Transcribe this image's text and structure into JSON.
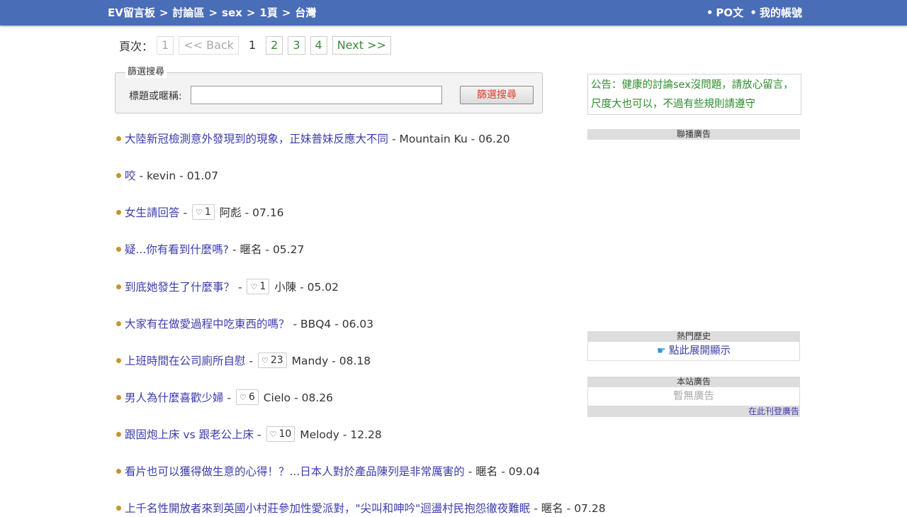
{
  "breadcrumb": {
    "items": [
      "EV留言板",
      "討論區",
      "sex",
      "1頁",
      "台灣"
    ],
    "separator": ">"
  },
  "top_nav": {
    "dot": "•",
    "post_label": "PO文",
    "account_label": "我的帳號"
  },
  "pager": {
    "label": "頁次：",
    "first": "1",
    "back": "<< Back",
    "current": "1",
    "pages": [
      "2",
      "3",
      "4"
    ],
    "next": "Next >>"
  },
  "filter": {
    "legend": "篩選搜尋",
    "field_label": "標題或暱稱:",
    "field_value": "",
    "button_label": "篩選搜尋"
  },
  "posts": [
    {
      "title": "大陸新冠檢測意外發現到的現象，正妹普妹反應大不同",
      "like": "",
      "author": "Mountain Ku",
      "date": "06.20"
    },
    {
      "title": "咬",
      "like": "",
      "author": "kevin",
      "date": "01.07"
    },
    {
      "title": "女生請回答",
      "like": "1",
      "author": "阿彪",
      "date": "07.16"
    },
    {
      "title": "疑...你有看到什麼嗎?",
      "like": "",
      "author": "暱名",
      "date": "05.27"
    },
    {
      "title": "到底她發生了什麼事？",
      "like": "1",
      "author": "小陳",
      "date": "05.02"
    },
    {
      "title": "大家有在做愛過程中吃東西的嗎？",
      "like": "",
      "author": "BBQ4",
      "date": "06.03"
    },
    {
      "title": "上班時間在公司廁所自慰",
      "like": "23",
      "author": "Mandy",
      "date": "08.18"
    },
    {
      "title": "男人為什麼喜歡少婦",
      "like": "6",
      "author": "Cielo",
      "date": "08.26"
    },
    {
      "title": "跟固炮上床 vs 跟老公上床",
      "like": "10",
      "author": "Melody",
      "date": "12.28"
    },
    {
      "title": "看片也可以獲得做生意的心得！？...日本人對於產品陳列是非常厲害的",
      "like": "",
      "author": "暱名",
      "date": "09.04"
    },
    {
      "title": "上千名性開放者來到英國小村莊參加性愛派對，\"尖叫和呻吟\"迴盪村民抱怨徹夜難眠",
      "like": "",
      "author": "暱名",
      "date": "07.28"
    }
  ],
  "sidebar": {
    "notice": "公告：健康的討論sex沒問題，請放心留言，尺度大也可以，不過有些規則請遵守",
    "ads_header": "聯播廣告",
    "hot_header": "熱門歷史",
    "hot_link": "點此展開顯示",
    "hand_icon": "☛",
    "site_ads_header": "本站廣告",
    "site_ads_empty": "暫無廣告",
    "site_ads_link": "在此刊登廣告"
  },
  "colors": {
    "topbar": "#4a6db8",
    "link": "#3c3caa",
    "notice": "#2e8b2e",
    "filter_button_text": "#e0382a",
    "bullet": "#c9942a"
  }
}
